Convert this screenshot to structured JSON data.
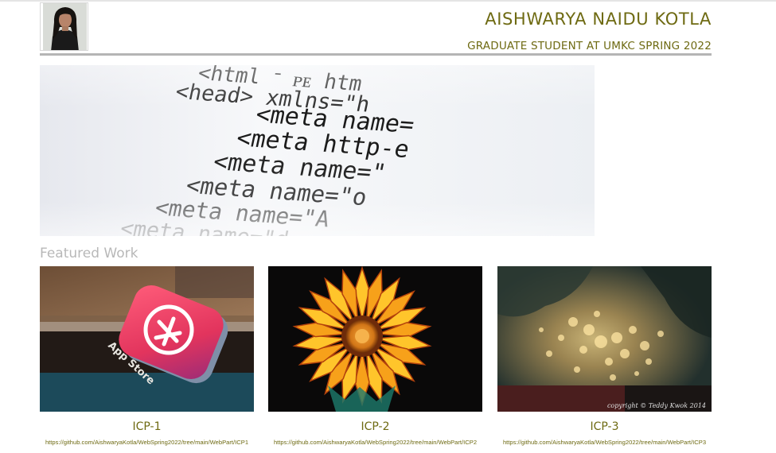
{
  "header": {
    "name": "AISHWARYA NAIDU KOTLA",
    "subtitle": "GRADUATE STUDENT AT UMKC SPRING 2022"
  },
  "hero": {
    "code_lines": [
      "<html  ᐨ  ᴘᴇ  htm",
      "<head>  xmlns=\"h",
      "<meta  name=",
      "<meta  http-e",
      "<meta  name=\"",
      "<meta  name=\"o",
      "<meta  name=\"A",
      "<meta  name=\"d"
    ]
  },
  "featured": {
    "heading": "Featured Work",
    "cards": [
      {
        "title": "ICP-1",
        "link": "https://github.com/AishwaryaKotla/WebSpring2022/tree/main/WebPart/ICP1",
        "image_caption": "App Store"
      },
      {
        "title": "ICP-2",
        "link": "https://github.com/AishwaryaKotla/WebSpring2022/tree/main/WebPart/ICP2"
      },
      {
        "title": "ICP-3",
        "link": "https://github.com/AishwaryaKotla/WebSpring2022/tree/main/WebPart/ICP3",
        "image_caption": "copyright © Teddy Kwok 2014"
      }
    ]
  },
  "colors": {
    "accent": "#6e6a12",
    "heading_gray": "#b8b8b8",
    "rule_gray": "#b5b5b5"
  }
}
